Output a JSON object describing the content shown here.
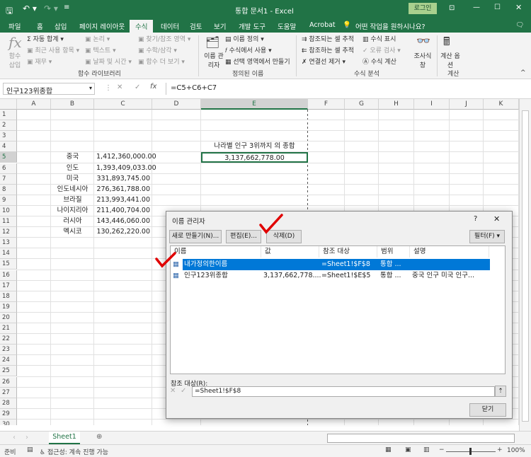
{
  "title": "통합 문서1 - Excel",
  "login": "로그인",
  "tabs": [
    "파일",
    "홈",
    "삽입",
    "페이지 레이아웃",
    "수식",
    "데이터",
    "검토",
    "보기",
    "개발 도구",
    "도움말",
    "Acrobat"
  ],
  "active_tab": "수식",
  "tell_me": "어떤 작업을 원하시나요?",
  "ribbon": {
    "insert_function": "함수 삽입",
    "autosum": "자동 합계",
    "recent": "최근 사용 항목",
    "finance": "재무",
    "logical": "논리",
    "text": "텍스트",
    "datetime": "날짜 및 시간",
    "lookup": "찾기/참조 영역",
    "math": "수학/삼각",
    "more": "함수 더 보기",
    "group1": "함수 라이브러리",
    "name_manager": "이름 관리자",
    "define_name": "이름 정의",
    "use_in_formula": "수식에서 사용",
    "create_from_sel": "선택 영역에서 만들기",
    "group2": "정의된 이름",
    "trace_prec": "참조되는 셀 추적",
    "trace_dep": "참조하는 셀 추적",
    "remove_arrows": "연결선 제거",
    "show_formulas": "수식 표시",
    "error_check": "오류 검사",
    "evaluate": "수식 계산",
    "watch": "조사식 창",
    "group3": "수식 분석",
    "calc_options": "계산 옵션",
    "group4": "계산"
  },
  "name_box": "인구123위종합",
  "formula": "=C5+C6+C7",
  "columns": [
    "A",
    "B",
    "C",
    "D",
    "E",
    "F",
    "G",
    "H",
    "I",
    "J",
    "K"
  ],
  "rows": 30,
  "cells": {
    "E4": "나라별 인구 3위까지 의 종합",
    "E5": "3,137,662,778.00",
    "B5": "중국",
    "C5": "1,412,360,000.00",
    "B6": "인도",
    "C6": "1,393,409,033.00",
    "B7": "미국",
    "C7": "331,893,745.00",
    "B8": "인도네시아",
    "C8": "276,361,788.00",
    "B9": "브라질",
    "C9": "213,993,441.00",
    "B10": "나이지리아",
    "C10": "211,400,704.00",
    "B11": "러시아",
    "C11": "143,446,060.00",
    "B12": "멕시코",
    "C12": "130,262,220.00"
  },
  "dialog": {
    "title": "이름 관리자",
    "help": "?",
    "close": "✕",
    "new": "새로 만들기(N)...",
    "edit": "편집(E)...",
    "delete": "삭제(D)",
    "filter": "필터(F) ▾",
    "headers": [
      "이름",
      "값",
      "참조 대상",
      "범위",
      "설명"
    ],
    "items": [
      {
        "name": "내가정의한이름",
        "value": "",
        "ref": "=Sheet1!$F$8",
        "scope": "통합 ...",
        "desc": "",
        "selected": true
      },
      {
        "name": "인구123위종합",
        "value": "3,137,662,778....",
        "ref": "=Sheet1!$E$5",
        "scope": "통합 ...",
        "desc": "중국 인구 미국 인구..."
      }
    ],
    "ref_label": "참조 대상(R):",
    "ref_value": "=Sheet1!$F$8",
    "close_btn": "닫기"
  },
  "sheet_tab": "Sheet1",
  "status": {
    "ready": "준비",
    "accessibility": "접근성: 계속 진행 가능",
    "zoom": "100%"
  },
  "colors": {
    "excel_green": "#217346",
    "selection": "#0078d7",
    "annotation": "#e00000"
  }
}
